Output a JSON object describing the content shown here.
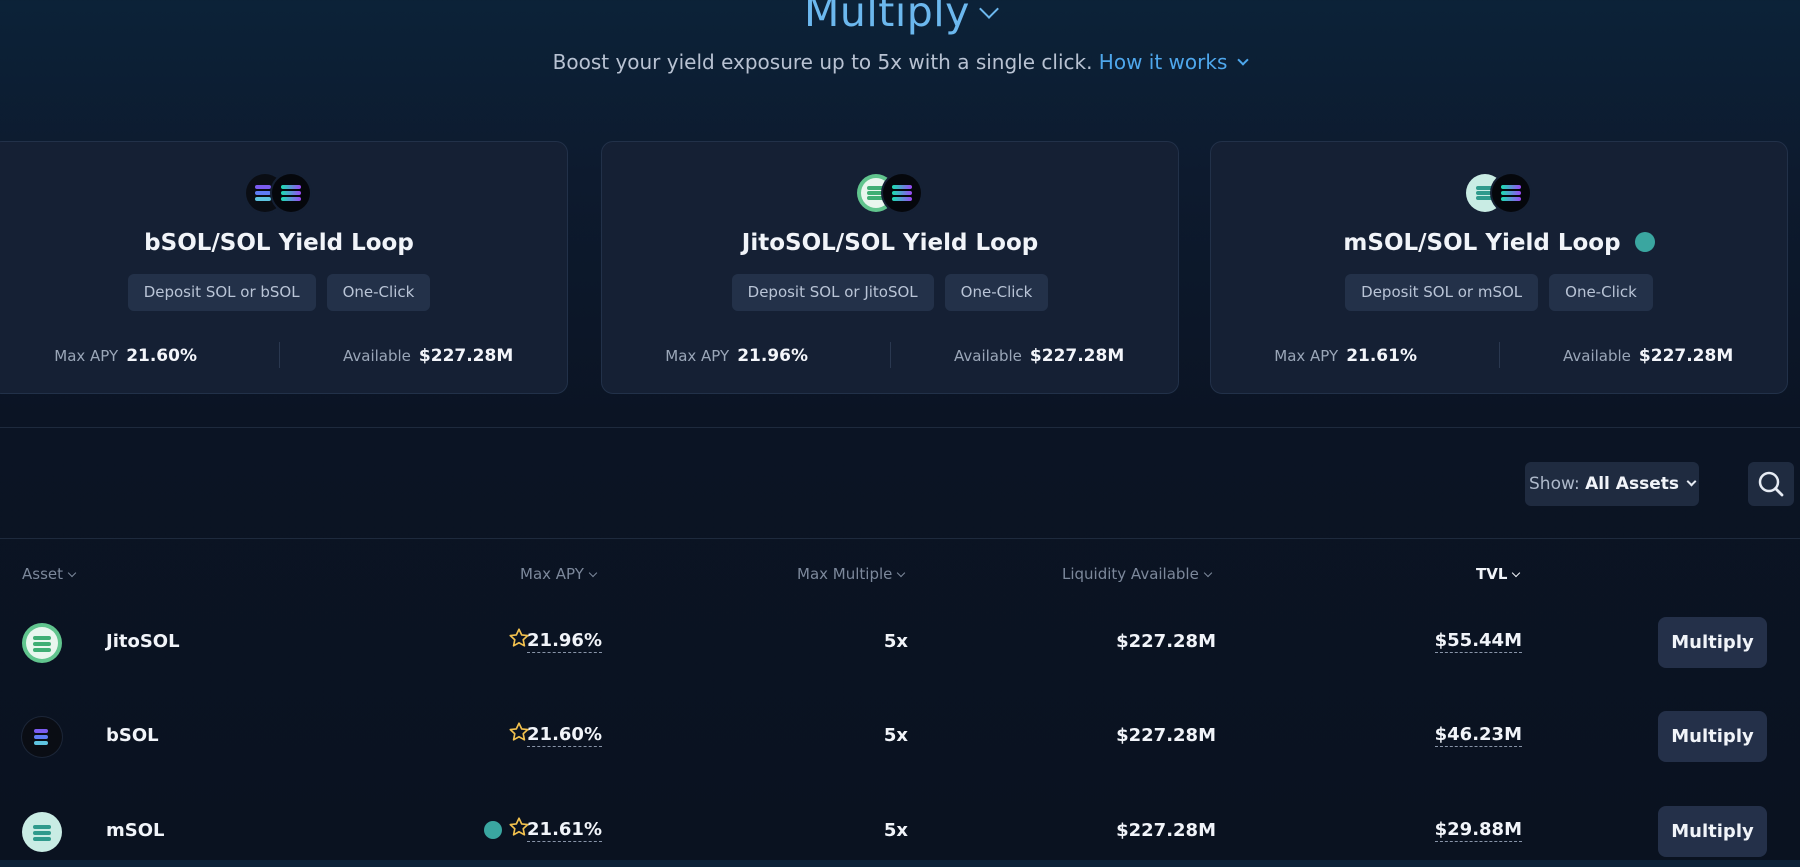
{
  "header": {
    "title": "Multiply",
    "subtitle": "Boost your yield exposure up to 5x with a single click.",
    "link_text": "How it works"
  },
  "cards": [
    {
      "name": "bSOL/SOL Yield Loop",
      "tags": [
        "Deposit SOL or bSOL",
        "One-Click"
      ],
      "max_apy_label": "Max APY",
      "max_apy": "21.60%",
      "available_label": "Available",
      "available": "$227.28M"
    },
    {
      "name": "JitoSOL/SOL Yield Loop",
      "tags": [
        "Deposit SOL or JitoSOL",
        "One-Click"
      ],
      "max_apy_label": "Max APY",
      "max_apy": "21.96%",
      "available_label": "Available",
      "available": "$227.28M"
    },
    {
      "name": "mSOL/SOL Yield Loop",
      "tags": [
        "Deposit SOL or mSOL",
        "One-Click"
      ],
      "max_apy_label": "Max APY",
      "max_apy": "21.61%",
      "available_label": "Available",
      "available": "$227.28M"
    }
  ],
  "filter": {
    "show_label": "Show:",
    "show_value": "All Assets"
  },
  "table": {
    "columns": [
      "Asset",
      "Max APY",
      "Max Multiple",
      "Liquidity Available",
      "TVL"
    ],
    "sorted_column": "TVL",
    "rows": [
      {
        "asset": "JitoSOL",
        "max_apy": "21.96%",
        "max_multiple": "5x",
        "liquidity": "$227.28M",
        "tvl": "$55.44M",
        "action": "Multiply"
      },
      {
        "asset": "bSOL",
        "max_apy": "21.60%",
        "max_multiple": "5x",
        "liquidity": "$227.28M",
        "tvl": "$46.23M",
        "action": "Multiply"
      },
      {
        "asset": "mSOL",
        "max_apy": "21.61%",
        "max_multiple": "5x",
        "liquidity": "$227.28M",
        "tvl": "$29.88M",
        "action": "Multiply"
      }
    ]
  },
  "icons": {
    "title_chevron": "chevron-down-icon",
    "search": "search-icon",
    "star": "star-icon",
    "marinade_badge": "marinade-badge-icon"
  },
  "colors": {
    "accent": "#6cb8ee",
    "link": "#4ea7ec",
    "star": "#f2c14e",
    "card_bg": "#152034",
    "button_bg": "#243049"
  }
}
